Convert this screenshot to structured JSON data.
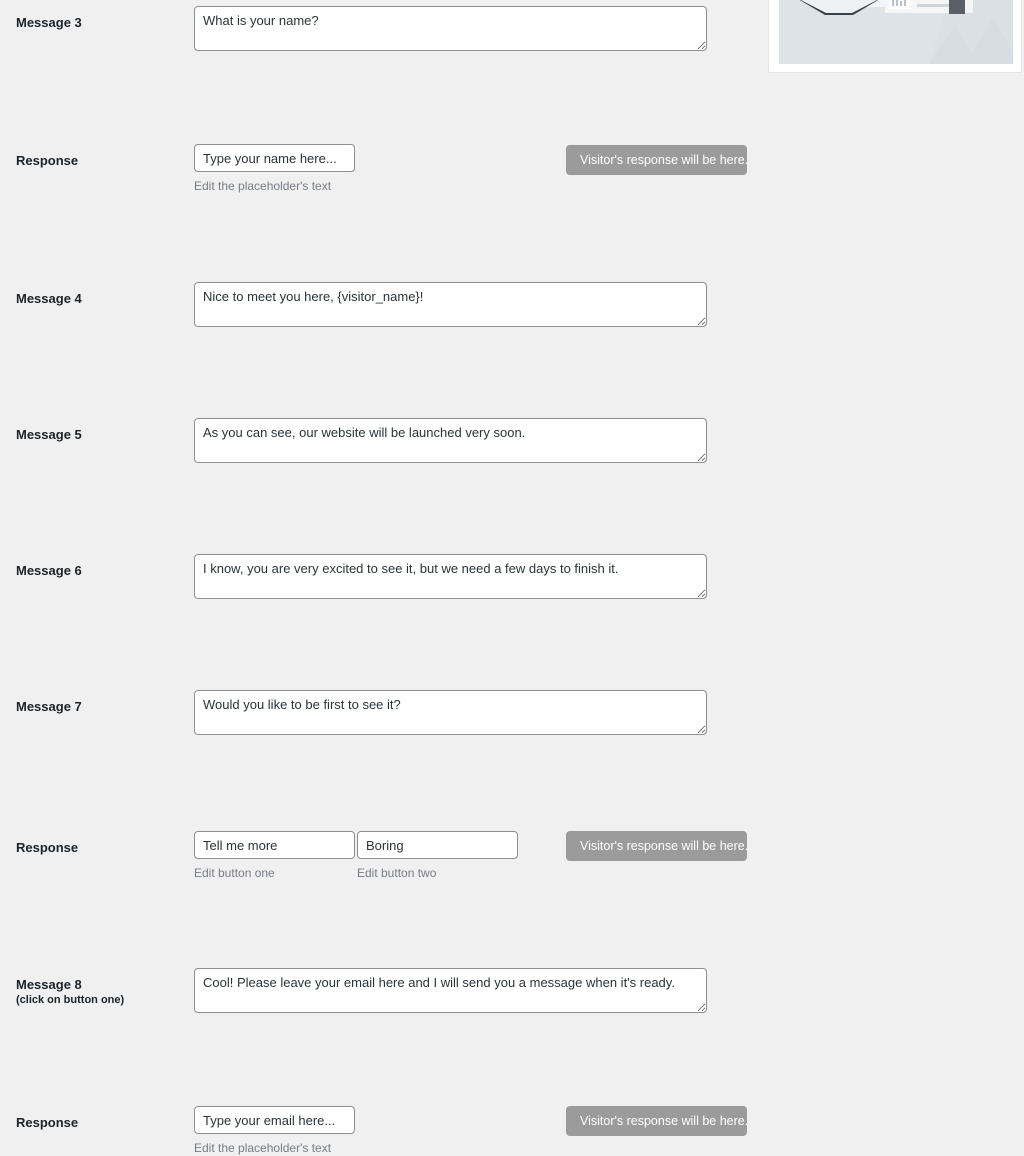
{
  "colors": {
    "page_background": "#f0f0f1",
    "field_border": "#8c8f94",
    "label_text": "#1d2327",
    "hint_text": "#787c82",
    "visitor_bubble": "#9b9b9b",
    "illustration_background": "#dde3e7",
    "illustration_accent_red": "#d45b52",
    "illustration_accent_green": "#c3d63f"
  },
  "promo": {
    "name": "website-launch-illustration"
  },
  "rows": [
    {
      "id": "message-3",
      "label": "Message 3",
      "sublabel": "",
      "type": "textarea",
      "value": "What is your name?",
      "hint": "",
      "visitor_bubble": ""
    },
    {
      "id": "response-name",
      "label": "Response",
      "sublabel": "",
      "type": "input",
      "value": "Type your name here...",
      "hint": "Edit the placeholder's text",
      "visitor_bubble": "Visitor's response will be here."
    },
    {
      "id": "message-4",
      "label": "Message 4",
      "sublabel": "",
      "type": "textarea",
      "value": "Nice to meet you here, {visitor_name}!",
      "hint": "",
      "visitor_bubble": ""
    },
    {
      "id": "message-5",
      "label": "Message 5",
      "sublabel": "",
      "type": "textarea",
      "value": "As you can see, our website will be launched very soon.",
      "hint": "",
      "visitor_bubble": ""
    },
    {
      "id": "message-6",
      "label": "Message 6",
      "sublabel": "",
      "type": "textarea",
      "value": "I know, you are very excited to see it, but we need a few days to finish it.",
      "hint": "",
      "visitor_bubble": ""
    },
    {
      "id": "message-7",
      "label": "Message 7",
      "sublabel": "",
      "type": "textarea",
      "value": "Would you like to be first to see it?",
      "hint": "",
      "visitor_bubble": ""
    },
    {
      "id": "response-buttons",
      "label": "Response",
      "sublabel": "",
      "type": "button-pair",
      "button_one_value": "Tell me more",
      "button_one_hint": "Edit button one",
      "button_two_value": "Boring",
      "button_two_hint": "Edit button two",
      "visitor_bubble": "Visitor's response will be here."
    },
    {
      "id": "message-8",
      "label": "Message 8",
      "sublabel": "(click on button one)",
      "type": "textarea",
      "value": "Cool! Please leave your email here and I will send you a message when it's ready.",
      "hint": "",
      "visitor_bubble": ""
    },
    {
      "id": "response-email",
      "label": "Response",
      "sublabel": "",
      "type": "input",
      "value": "Type your email here...",
      "hint": "Edit the placeholder's text",
      "visitor_bubble": "Visitor's response will be here."
    }
  ]
}
